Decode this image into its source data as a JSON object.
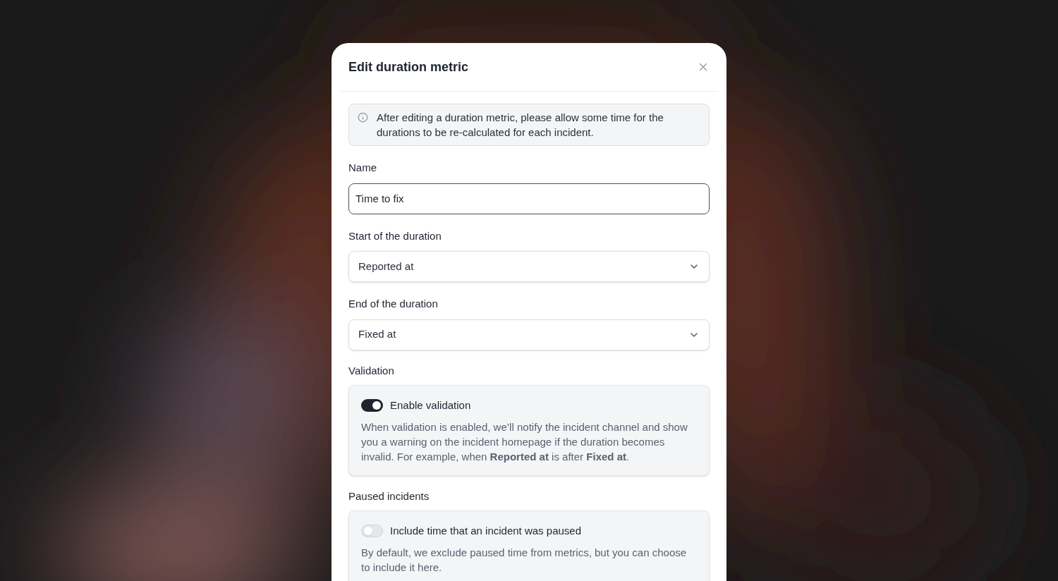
{
  "dialog": {
    "title": "Edit duration metric"
  },
  "notice": "After editing a duration metric, please allow some time for the durations to be re-calculated for each incident.",
  "fields": [
    {
      "kind": "input",
      "label": "Name",
      "value": "Time to fix"
    },
    {
      "kind": "select",
      "label": "Start of the duration",
      "value": "Reported at"
    },
    {
      "kind": "select",
      "label": "End of the duration",
      "value": "Fixed at"
    }
  ],
  "sections": [
    {
      "label": "Validation",
      "toggle": {
        "label": "Enable validation",
        "on": true
      },
      "description": "When validation is enabled, we’ll notify the incident channel and show you a warning on the incident homepage if the duration becomes invalid. For example, when **Reported at** is after **Fixed at**."
    },
    {
      "label": "Paused incidents",
      "toggle": {
        "label": "Include time that an incident was paused",
        "on": false
      },
      "description": "By default, we exclude paused time from metrics, but you can choose to include it here."
    }
  ]
}
